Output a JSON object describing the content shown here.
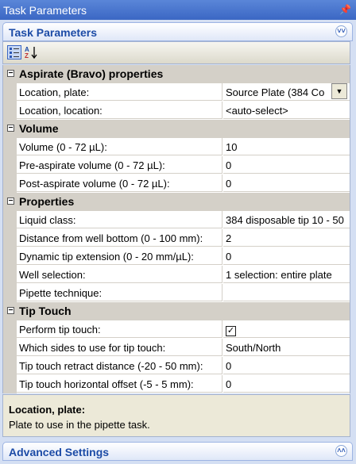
{
  "window": {
    "title": "Task Parameters",
    "pin_glyph": "ṙ"
  },
  "panel": {
    "title": "Task Parameters",
    "chevron": "»"
  },
  "toolbar": {
    "categorized_icon": "categorized-view-icon",
    "alpha_icon": "alphabetical-sort-icon"
  },
  "categories": [
    {
      "label": "Aspirate (Bravo) properties",
      "toggle": "−",
      "props": [
        {
          "name": "Location, plate:",
          "value": "Source Plate  (384 Co"
        },
        {
          "name": "Location, location:",
          "value": "<auto-select>"
        }
      ]
    },
    {
      "label": "Volume",
      "toggle": "−",
      "props": [
        {
          "name": "Volume (0 - 72 µL):",
          "value": "10"
        },
        {
          "name": "Pre-aspirate volume (0 - 72 µL):",
          "value": "0"
        },
        {
          "name": "Post-aspirate volume (0 - 72 µL):",
          "value": "0"
        }
      ]
    },
    {
      "label": "Properties",
      "toggle": "−",
      "props": [
        {
          "name": "Liquid class:",
          "value": "384 disposable tip 10 - 50"
        },
        {
          "name": "Distance from well bottom (0 - 100 mm):",
          "value": "2"
        },
        {
          "name": "Dynamic tip extension (0 - 20 mm/µL):",
          "value": "0"
        },
        {
          "name": "Well selection:",
          "value": "1 selection: entire plate"
        },
        {
          "name": "Pipette technique:",
          "value": ""
        }
      ]
    },
    {
      "label": "Tip Touch",
      "toggle": "−",
      "props": [
        {
          "name": "Perform tip touch:",
          "value": "✓"
        },
        {
          "name": "Which sides to use for tip touch:",
          "value": "South/North"
        },
        {
          "name": "Tip touch retract distance (-20 - 50 mm):",
          "value": "0"
        },
        {
          "name": "Tip touch horizontal offset (-5 - 5 mm):",
          "value": "0"
        }
      ]
    }
  ],
  "description": {
    "title": "Location, plate:",
    "text": "Plate to use in the pipette task."
  },
  "advanced": {
    "title": "Advanced Settings",
    "chevron": "«"
  }
}
